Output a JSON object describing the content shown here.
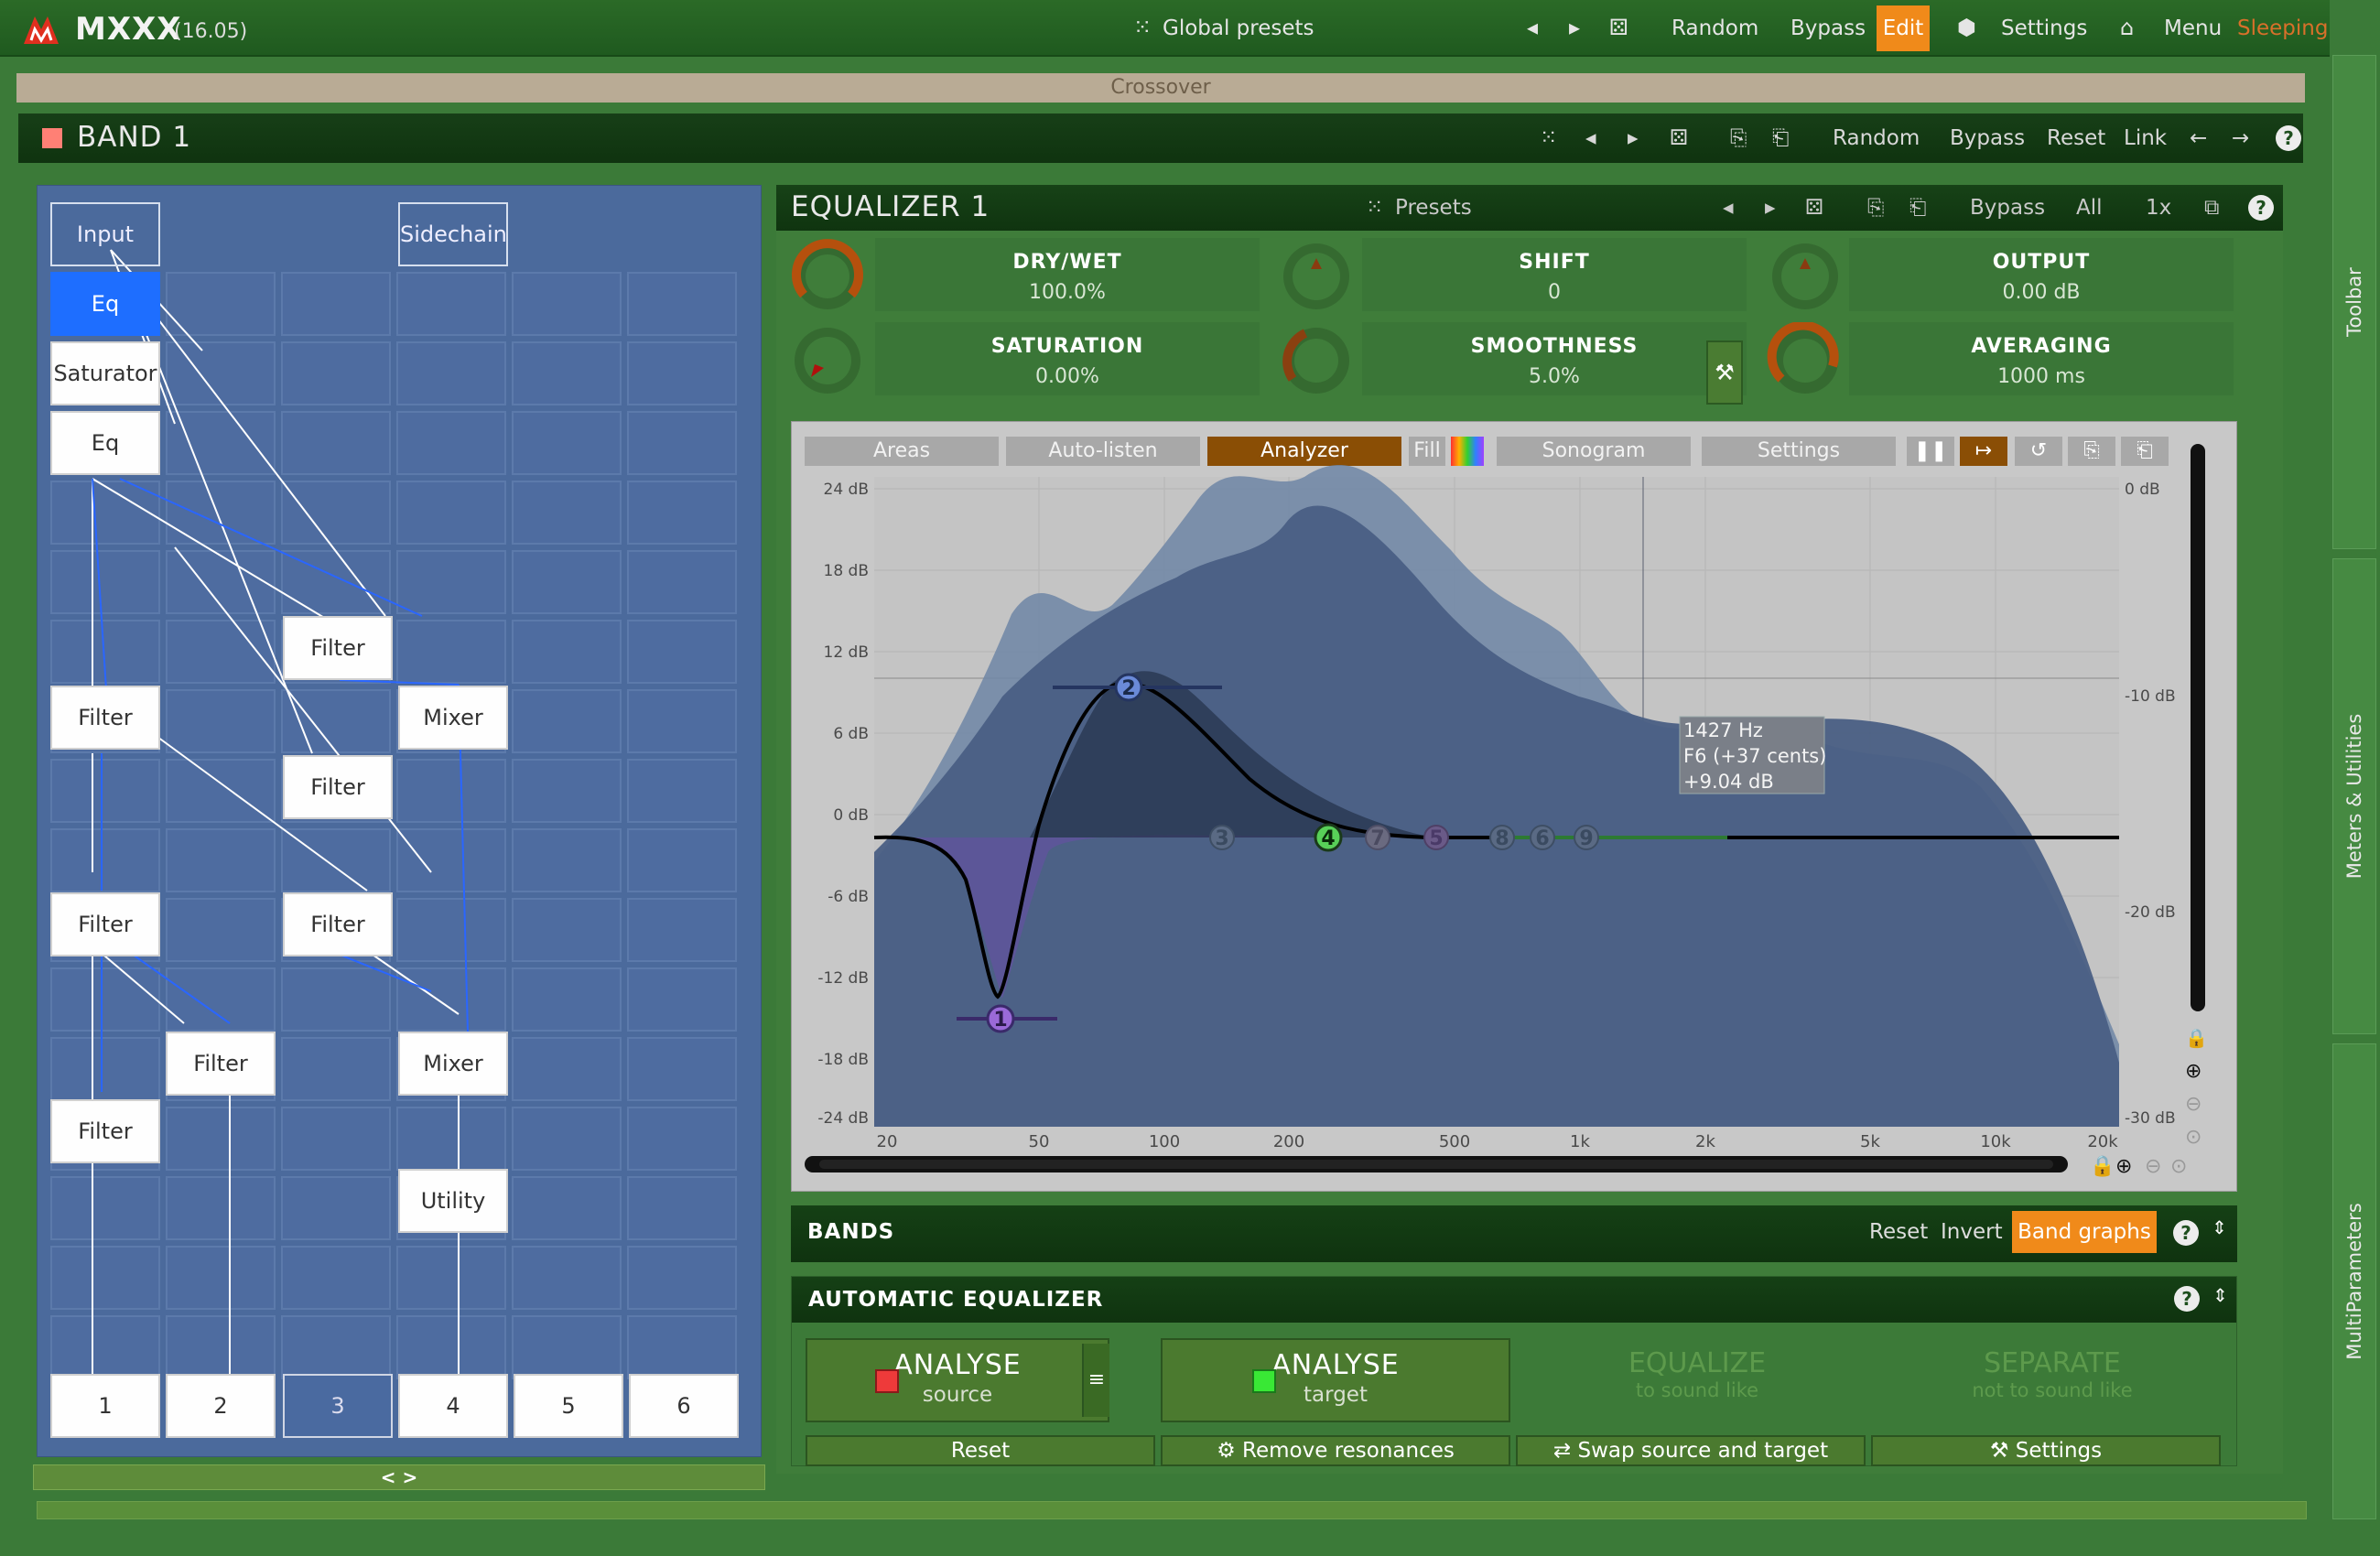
{
  "app": {
    "name": "MXXX",
    "version": "(16.05)",
    "global_presets": "Global presets",
    "random": "Random",
    "bypass": "Bypass",
    "edit": "Edit",
    "settings": "Settings",
    "menu": "Menu",
    "sleeping": "Sleeping",
    "help": "?"
  },
  "crossover": "Crossover",
  "band": {
    "title": "BAND 1",
    "random": "Random",
    "bypass": "Bypass",
    "reset": "Reset",
    "link": "Link",
    "help": "?"
  },
  "sidebar": {
    "toolbar": "Toolbar",
    "meters": "Meters & Utilities",
    "multiparameters": "MultiParameters"
  },
  "grid": {
    "nodes": {
      "input": "Input",
      "sidechain": "Sidechain",
      "eq_selected": "Eq",
      "saturator": "Saturator",
      "eq": "Eq",
      "filter_a": "Filter",
      "filter_b": "Filter",
      "mixer_a": "Mixer",
      "filter_c": "Filter",
      "filter_d": "Filter",
      "filter_e": "Filter",
      "filter_f": "Filter",
      "mixer_b": "Mixer",
      "filter_g": "Filter",
      "utility": "Utility"
    },
    "outputs": [
      "1",
      "2",
      "3",
      "4",
      "5",
      "6"
    ],
    "expand": "< >"
  },
  "equalizer": {
    "title": "EQUALIZER 1",
    "presets": "Presets",
    "bypass": "Bypass",
    "all": "All",
    "zoom": "1x",
    "help": "?",
    "params": {
      "drywet": {
        "label": "DRY/WET",
        "value": "100.0%"
      },
      "shift": {
        "label": "SHIFT",
        "value": "0"
      },
      "output": {
        "label": "OUTPUT",
        "value": "0.00 dB"
      },
      "saturation": {
        "label": "SATURATION",
        "value": "0.00%"
      },
      "smoothness": {
        "label": "SMOOTHNESS",
        "value": "5.0%"
      },
      "averaging": {
        "label": "AVERAGING",
        "value": "1000 ms"
      }
    }
  },
  "graph": {
    "tabs": {
      "areas": "Areas",
      "autolisten": "Auto-listen",
      "analyzer": "Analyzer",
      "fill": "Fill",
      "sonogram": "Sonogram",
      "settings": "Settings"
    },
    "y_labels": [
      "24 dB",
      "18 dB",
      "12 dB",
      "6 dB",
      "0 dB",
      "-6 dB",
      "-12 dB",
      "-18 dB",
      "-24 dB"
    ],
    "y_right_labels": [
      "0 dB",
      "-10 dB",
      "-20 dB",
      "-30 dB"
    ],
    "x_labels": [
      "20",
      "50",
      "100",
      "200",
      "500",
      "1k",
      "2k",
      "5k",
      "10k",
      "20k"
    ],
    "band_numbers": [
      "1",
      "2",
      "3",
      "4",
      "5",
      "6",
      "7",
      "8",
      "9"
    ],
    "tooltip": {
      "line1": "1427 Hz",
      "line2": "F6 (+37 cents)",
      "line3": "+9.04 dB"
    }
  },
  "bands": {
    "title": "BANDS",
    "reset": "Reset",
    "invert": "Invert",
    "band_graphs": "Band graphs",
    "help": "?"
  },
  "auto_eq": {
    "title": "AUTOMATIC EQUALIZER",
    "help": "?",
    "analyse_source": {
      "title": "ANALYSE",
      "sub": "source"
    },
    "analyse_target": {
      "title": "ANALYSE",
      "sub": "target"
    },
    "equalize": {
      "title": "EQUALIZE",
      "sub": "to sound like"
    },
    "separate": {
      "title": "SEPARATE",
      "sub": "not to sound like"
    },
    "reset": "Reset",
    "remove_resonances": "Remove resonances",
    "swap": "Swap source and target",
    "settings": "Settings",
    "menu": "≡"
  },
  "colors": {
    "source": "#ee3a3a",
    "target": "#39e835",
    "accent": "#f08a1a",
    "selected_node": "#1e6eff"
  }
}
